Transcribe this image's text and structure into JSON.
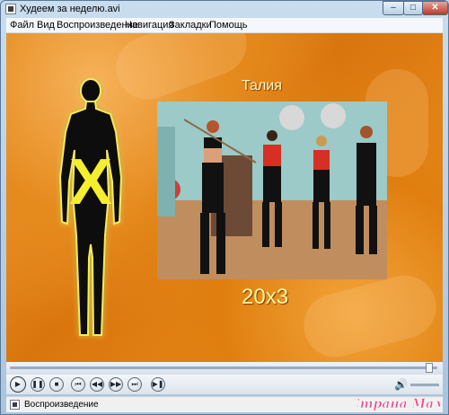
{
  "window": {
    "title": "Худеем за неделю.avi",
    "controls": {
      "minimize": "‒",
      "maximize": "□",
      "close": "✕"
    }
  },
  "menu": {
    "items": [
      {
        "label": "Файл"
      },
      {
        "label": "Вид"
      },
      {
        "label": "Воспроизведение"
      },
      {
        "label": "Навигация"
      },
      {
        "label": "Закладки"
      },
      {
        "label": "Помощь"
      }
    ]
  },
  "video": {
    "silhouette_letter": "X",
    "slide_title": "Талия",
    "reps": "20x3"
  },
  "playback": {
    "progress": 0.99,
    "buttons": {
      "play": "▶",
      "pause": "❚❚",
      "stop": "■",
      "prev_chapter": "⏮",
      "rewind": "◀◀",
      "forward": "▶▶",
      "next_chapter": "⏭",
      "frame_step": "▶❚"
    },
    "volume_icon": "speaker-icon",
    "volume": 1.0
  },
  "status": {
    "text": "Воспроизведение"
  },
  "watermark": {
    "text": "Страна Мам"
  },
  "colors": {
    "accent": "#e58a1d",
    "title_text": "#fff9c8",
    "reps_text": "#fff9a0"
  }
}
